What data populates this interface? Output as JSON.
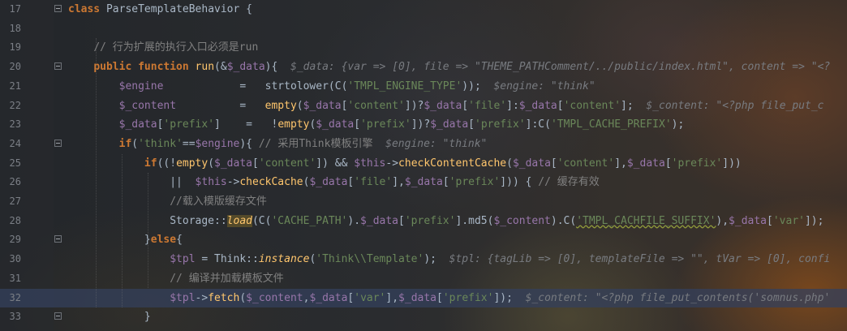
{
  "editor": {
    "lines": [
      {
        "num": "17",
        "fold": true,
        "current": false,
        "tokens": [
          {
            "c": "kw",
            "t": "class"
          },
          {
            "c": "plain",
            "t": " ParseTemplateBehavior {"
          }
        ]
      },
      {
        "num": "18",
        "current": false,
        "tokens": []
      },
      {
        "num": "19",
        "current": false,
        "tokens": [
          {
            "c": "plain",
            "t": "    "
          },
          {
            "c": "cm",
            "t": "// 行为扩展的执行入口必须是run"
          }
        ]
      },
      {
        "num": "20",
        "fold": true,
        "current": false,
        "tokens": [
          {
            "c": "plain",
            "t": "    "
          },
          {
            "c": "kw",
            "t": "public function "
          },
          {
            "c": "fn",
            "t": "run"
          },
          {
            "c": "plain",
            "t": "(&"
          },
          {
            "c": "var",
            "t": "$_data"
          },
          {
            "c": "plain",
            "t": "){  "
          },
          {
            "c": "hint",
            "t": "$_data: {var => [0], file => \"THEME_PATHComment/../public/index.html\", content => \"<?"
          }
        ]
      },
      {
        "num": "21",
        "current": false,
        "tokens": [
          {
            "c": "plain",
            "t": "        "
          },
          {
            "c": "var",
            "t": "$engine"
          },
          {
            "c": "plain",
            "t": "            =   strtolower(C("
          },
          {
            "c": "str",
            "t": "'TMPL_ENGINE_TYPE'"
          },
          {
            "c": "plain",
            "t": "));  "
          },
          {
            "c": "hint",
            "t": "$engine: \"think\""
          }
        ]
      },
      {
        "num": "22",
        "current": false,
        "tokens": [
          {
            "c": "plain",
            "t": "        "
          },
          {
            "c": "var",
            "t": "$_content"
          },
          {
            "c": "plain",
            "t": "          =   "
          },
          {
            "c": "fn",
            "t": "empty"
          },
          {
            "c": "plain",
            "t": "("
          },
          {
            "c": "var",
            "t": "$_data"
          },
          {
            "c": "plain",
            "t": "["
          },
          {
            "c": "str",
            "t": "'content'"
          },
          {
            "c": "plain",
            "t": "])?"
          },
          {
            "c": "var",
            "t": "$_data"
          },
          {
            "c": "plain",
            "t": "["
          },
          {
            "c": "str",
            "t": "'file'"
          },
          {
            "c": "plain",
            "t": "]:"
          },
          {
            "c": "var",
            "t": "$_data"
          },
          {
            "c": "plain",
            "t": "["
          },
          {
            "c": "str",
            "t": "'content'"
          },
          {
            "c": "plain",
            "t": "];  "
          },
          {
            "c": "hint",
            "t": "$_content: \"<?php file_put_c"
          }
        ]
      },
      {
        "num": "23",
        "current": false,
        "tokens": [
          {
            "c": "plain",
            "t": "        "
          },
          {
            "c": "var",
            "t": "$_data"
          },
          {
            "c": "plain",
            "t": "["
          },
          {
            "c": "str",
            "t": "'prefix'"
          },
          {
            "c": "plain",
            "t": "]    =   !"
          },
          {
            "c": "fn",
            "t": "empty"
          },
          {
            "c": "plain",
            "t": "("
          },
          {
            "c": "var",
            "t": "$_data"
          },
          {
            "c": "plain",
            "t": "["
          },
          {
            "c": "str",
            "t": "'prefix'"
          },
          {
            "c": "plain",
            "t": "])?"
          },
          {
            "c": "var",
            "t": "$_data"
          },
          {
            "c": "plain",
            "t": "["
          },
          {
            "c": "str",
            "t": "'prefix'"
          },
          {
            "c": "plain",
            "t": "]:C("
          },
          {
            "c": "str",
            "t": "'TMPL_CACHE_PREFIX'"
          },
          {
            "c": "plain",
            "t": ");"
          }
        ]
      },
      {
        "num": "24",
        "fold": true,
        "current": false,
        "tokens": [
          {
            "c": "plain",
            "t": "        "
          },
          {
            "c": "kw",
            "t": "if"
          },
          {
            "c": "plain",
            "t": "("
          },
          {
            "c": "str",
            "t": "'think'"
          },
          {
            "c": "plain",
            "t": "=="
          },
          {
            "c": "var",
            "t": "$engine"
          },
          {
            "c": "plain",
            "t": "){ "
          },
          {
            "c": "cm",
            "t": "// 采用Think模板引擎"
          },
          {
            "c": "plain",
            "t": "  "
          },
          {
            "c": "hint",
            "t": "$engine: \"think\""
          }
        ]
      },
      {
        "num": "25",
        "current": false,
        "tokens": [
          {
            "c": "plain",
            "t": "            "
          },
          {
            "c": "kw",
            "t": "if"
          },
          {
            "c": "plain",
            "t": "((!"
          },
          {
            "c": "fn",
            "t": "empty"
          },
          {
            "c": "plain",
            "t": "("
          },
          {
            "c": "var",
            "t": "$_data"
          },
          {
            "c": "plain",
            "t": "["
          },
          {
            "c": "str",
            "t": "'content'"
          },
          {
            "c": "plain",
            "t": "]) && "
          },
          {
            "c": "var",
            "t": "$this"
          },
          {
            "c": "plain",
            "t": "->"
          },
          {
            "c": "fn",
            "t": "checkContentCache"
          },
          {
            "c": "plain",
            "t": "("
          },
          {
            "c": "var",
            "t": "$_data"
          },
          {
            "c": "plain",
            "t": "["
          },
          {
            "c": "str",
            "t": "'content'"
          },
          {
            "c": "plain",
            "t": "],"
          },
          {
            "c": "var",
            "t": "$_data"
          },
          {
            "c": "plain",
            "t": "["
          },
          {
            "c": "str",
            "t": "'prefix'"
          },
          {
            "c": "plain",
            "t": "]))"
          }
        ]
      },
      {
        "num": "26",
        "current": false,
        "tokens": [
          {
            "c": "plain",
            "t": "                ||  "
          },
          {
            "c": "var",
            "t": "$this"
          },
          {
            "c": "plain",
            "t": "->"
          },
          {
            "c": "fn",
            "t": "checkCache"
          },
          {
            "c": "plain",
            "t": "("
          },
          {
            "c": "var",
            "t": "$_data"
          },
          {
            "c": "plain",
            "t": "["
          },
          {
            "c": "str",
            "t": "'file'"
          },
          {
            "c": "plain",
            "t": "],"
          },
          {
            "c": "var",
            "t": "$_data"
          },
          {
            "c": "plain",
            "t": "["
          },
          {
            "c": "str",
            "t": "'prefix'"
          },
          {
            "c": "plain",
            "t": "])) { "
          },
          {
            "c": "cm",
            "t": "// 缓存有效"
          }
        ]
      },
      {
        "num": "27",
        "current": false,
        "tokens": [
          {
            "c": "plain",
            "t": "                "
          },
          {
            "c": "cm",
            "t": "//载入模版缓存文件"
          }
        ]
      },
      {
        "num": "28",
        "current": false,
        "tokens": [
          {
            "c": "plain",
            "t": "                Storage::"
          },
          {
            "c": "it hl-fn",
            "t": "load"
          },
          {
            "c": "plain",
            "t": "(C("
          },
          {
            "c": "str",
            "t": "'CACHE_PATH'"
          },
          {
            "c": "plain",
            "t": ")."
          },
          {
            "c": "var",
            "t": "$_data"
          },
          {
            "c": "plain",
            "t": "["
          },
          {
            "c": "str",
            "t": "'prefix'"
          },
          {
            "c": "plain",
            "t": "].md5("
          },
          {
            "c": "var",
            "t": "$_content"
          },
          {
            "c": "plain",
            "t": ").C("
          },
          {
            "c": "str sq",
            "t": "'TMPL_CACHFILE_SUFFIX'"
          },
          {
            "c": "plain",
            "t": "),"
          },
          {
            "c": "var",
            "t": "$_data"
          },
          {
            "c": "plain",
            "t": "["
          },
          {
            "c": "str",
            "t": "'var'"
          },
          {
            "c": "plain",
            "t": "]);"
          }
        ]
      },
      {
        "num": "29",
        "fold": true,
        "current": false,
        "tokens": [
          {
            "c": "plain",
            "t": "            }"
          },
          {
            "c": "kw",
            "t": "else"
          },
          {
            "c": "plain",
            "t": "{"
          }
        ]
      },
      {
        "num": "30",
        "current": false,
        "tokens": [
          {
            "c": "plain",
            "t": "                "
          },
          {
            "c": "var",
            "t": "$tpl"
          },
          {
            "c": "plain",
            "t": " = Think::"
          },
          {
            "c": "it",
            "t": "instance"
          },
          {
            "c": "plain",
            "t": "("
          },
          {
            "c": "str",
            "t": "'Think\\\\Template'"
          },
          {
            "c": "plain",
            "t": ");  "
          },
          {
            "c": "hint",
            "t": "$tpl: {tagLib => [0], templateFile => \"\", tVar => [0], confi"
          }
        ]
      },
      {
        "num": "31",
        "current": false,
        "tokens": [
          {
            "c": "plain",
            "t": "                "
          },
          {
            "c": "cm",
            "t": "// 编译并加载模板文件"
          }
        ]
      },
      {
        "num": "32",
        "current": true,
        "tokens": [
          {
            "c": "plain",
            "t": "                "
          },
          {
            "c": "var",
            "t": "$tpl"
          },
          {
            "c": "plain",
            "t": "->"
          },
          {
            "c": "fn",
            "t": "fetch"
          },
          {
            "c": "plain",
            "t": "("
          },
          {
            "c": "var",
            "t": "$_content"
          },
          {
            "c": "plain",
            "t": ","
          },
          {
            "c": "var",
            "t": "$_data"
          },
          {
            "c": "plain",
            "t": "["
          },
          {
            "c": "str",
            "t": "'var'"
          },
          {
            "c": "plain",
            "t": "],"
          },
          {
            "c": "var",
            "t": "$_data"
          },
          {
            "c": "plain",
            "t": "["
          },
          {
            "c": "str",
            "t": "'prefix'"
          },
          {
            "c": "plain",
            "t": "]);  "
          },
          {
            "c": "hint",
            "t": "$_content: \"<?php file_put_contents('somnus.php'"
          }
        ]
      },
      {
        "num": "33",
        "fold": true,
        "current": false,
        "tokens": [
          {
            "c": "plain",
            "t": "            }"
          }
        ]
      }
    ]
  }
}
